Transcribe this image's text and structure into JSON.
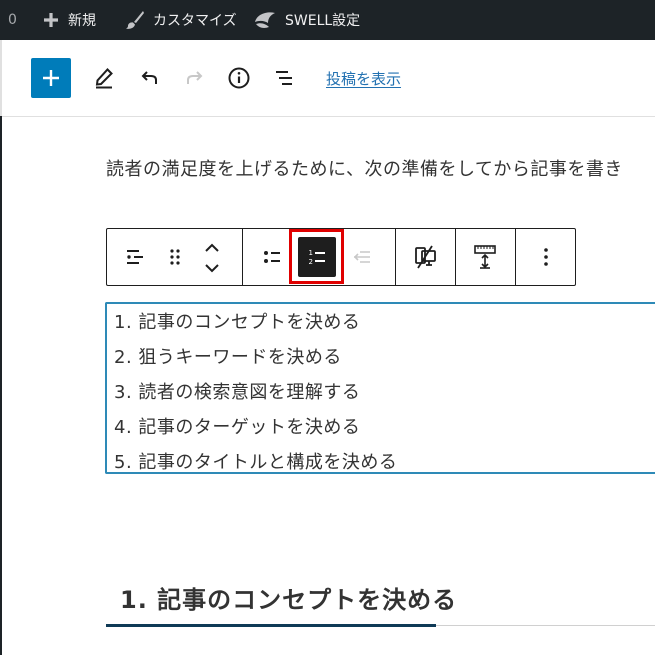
{
  "adminbar": {
    "count": "0",
    "new_label": "新規",
    "customize_label": "カスタマイズ",
    "swell_label": "SWELL設定"
  },
  "toolbar": {
    "view_post_label": "投稿を表示"
  },
  "content": {
    "paragraph": "読者の満足度を上げるために、次の準備をしてから記事を書き",
    "list_items": [
      "1. 記事のコンセプトを決める",
      "2. 狙うキーワードを決める",
      "3. 読者の検索意図を理解する",
      "4. 記事のターゲットを決める",
      "5. 記事のタイトルと構成を決める"
    ],
    "heading": "1. 記事のコンセプトを決める"
  },
  "colors": {
    "admin_bar": "#1d2327",
    "accent": "#007cba",
    "link": "#2271b1",
    "highlight": "#e00000",
    "list_border": "#2e8ab7",
    "heading_underline": "#0f3a56"
  }
}
